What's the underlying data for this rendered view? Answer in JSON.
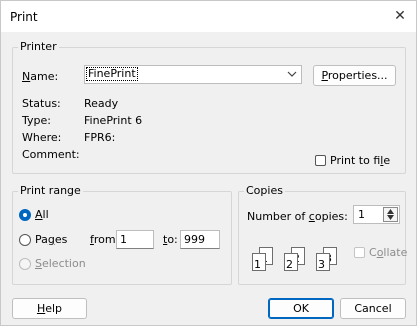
{
  "window": {
    "title": "Print",
    "close_glyph": "✕"
  },
  "printer": {
    "group_label": "Printer",
    "name_label_pre": "",
    "name_label_accel": "N",
    "name_label_post": "ame:",
    "name_value": "FinePrint",
    "properties_pre": "",
    "properties_accel": "P",
    "properties_post": "roperties...",
    "status_label": "Status:",
    "status_value": "Ready",
    "type_label": "Type:",
    "type_value": "FinePrint 6",
    "where_label": "Where:",
    "where_value": "FPR6:",
    "comment_label": "Comment:",
    "print_to_file_pre": "Print to fi",
    "print_to_file_accel": "l",
    "print_to_file_post": "e"
  },
  "print_range": {
    "group_label": "Print range",
    "all_accel": "A",
    "all_post": "ll",
    "pages_pre": "Pa",
    "pages_accel": "g",
    "pages_post": "es",
    "from_accel": "f",
    "from_post": "rom:",
    "from_value": "1",
    "to_accel": "t",
    "to_post": "o:",
    "to_value": "999",
    "selection_accel": "S",
    "selection_post": "election"
  },
  "copies": {
    "group_label": "Copies",
    "number_pre": "Number of ",
    "number_accel": "c",
    "number_post": "opies:",
    "number_value": "1",
    "collate_pre": "C",
    "collate_accel": "o",
    "collate_post": "llate",
    "page_labels": [
      "1",
      "1",
      "2",
      "2",
      "3",
      "3"
    ]
  },
  "buttons": {
    "help_accel": "H",
    "help_post": "elp",
    "ok": "OK",
    "cancel": "Cancel"
  },
  "colors": {
    "accent": "#0067c0",
    "dialog_bg": "#f0f0f0"
  },
  "icons": {
    "close": "close-icon",
    "dropdown": "chevron-down-icon",
    "spin_up": "spin-up-icon",
    "spin_down": "spin-down-icon"
  }
}
